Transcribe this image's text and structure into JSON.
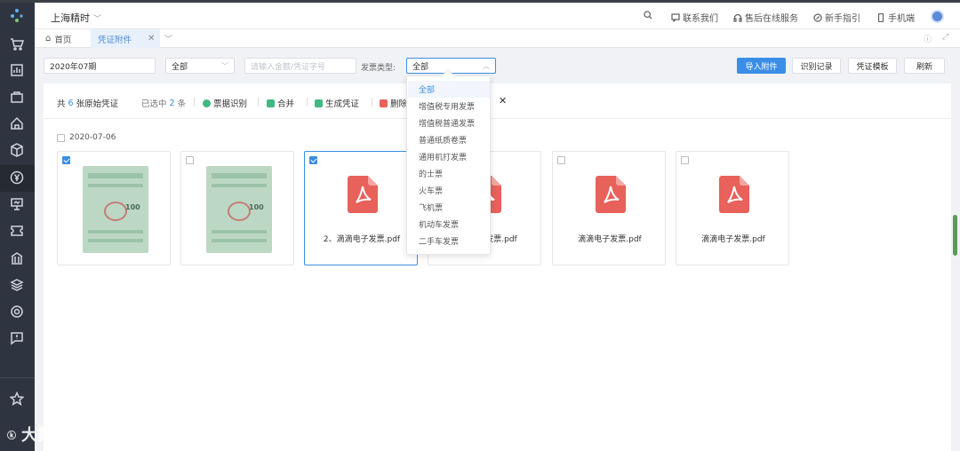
{
  "header": {
    "company": "上海精时",
    "search_icon": "search-icon",
    "links": [
      "联系我们",
      "售后在线服务",
      "新手指引",
      "手机端"
    ]
  },
  "tabs": {
    "home": "首页",
    "active": "凭证附件"
  },
  "filters": {
    "period": "2020年07期",
    "category": "全部",
    "search_placeholder": "请输入金额/凭证字号",
    "invoice_type_label": "发票类型:",
    "invoice_type_value": "全部"
  },
  "buttons": {
    "import": "导入附件",
    "recognize_log": "识别记录",
    "voucher_template": "凭证模板",
    "refresh": "刷新"
  },
  "toolbar": {
    "total_prefix": "共",
    "total_count": "6",
    "total_suffix": "张原始凭证",
    "selected_prefix": "已选中",
    "selected_count": "2",
    "selected_suffix": "条",
    "recognize": "票据识别",
    "merge": "合并",
    "generate": "生成凭证",
    "delete": "删除"
  },
  "group_date": "2020-07-06",
  "cards": [
    {
      "type": "image",
      "checked": true,
      "name": ""
    },
    {
      "type": "image",
      "checked": false,
      "name": ""
    },
    {
      "type": "pdf",
      "checked": true,
      "name": "2、滴滴电子发票.pdf"
    },
    {
      "type": "pdf",
      "checked": false,
      "name": "滴滴电子发票.pdf"
    },
    {
      "type": "pdf",
      "checked": false,
      "name": "滴滴电子发票.pdf"
    },
    {
      "type": "pdf",
      "checked": false,
      "name": "滴滴电子发票.pdf"
    }
  ],
  "dropdown_options": [
    "全部",
    "增值税专用发票",
    "增值税普通发票",
    "普通纸质卷票",
    "通用机打发票",
    "的士票",
    "火车票",
    "飞机票",
    "机动车发票",
    "二手车发票"
  ],
  "watermark": "大数跨境",
  "colors": {
    "primary": "#3a8ee6",
    "sidebar": "#2f3540",
    "pdf_red": "#e8615b"
  }
}
